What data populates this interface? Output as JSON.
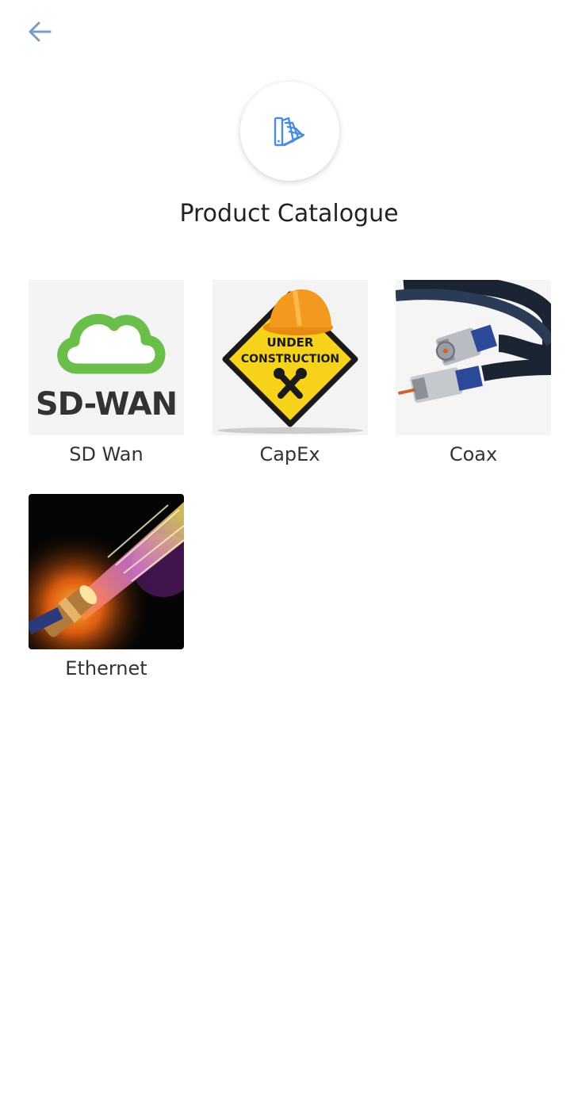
{
  "header": {
    "back_icon": "arrow-left-icon",
    "logo_icon": "catalogue-swatch-icon",
    "title": "Product Catalogue"
  },
  "colors": {
    "accent": "#4a8cdf",
    "back_arrow": "#7a9cc6",
    "cloud_green": "#6abf4b",
    "construction_yellow": "#f7d21a",
    "hard_hat_orange": "#f39a1e"
  },
  "catalogue": {
    "items": [
      {
        "label": "SD Wan",
        "image": "sd-wan-logo",
        "image_text": "SD-WAN"
      },
      {
        "label": "CapEx",
        "image": "under-construction-sign",
        "image_text_1": "UNDER",
        "image_text_2": "CONSTRUCTION"
      },
      {
        "label": "Coax",
        "image": "coax-cable-photo",
        "image_text": ""
      },
      {
        "label": "Ethernet",
        "image": "fiber-light-photo",
        "image_text": ""
      }
    ]
  }
}
